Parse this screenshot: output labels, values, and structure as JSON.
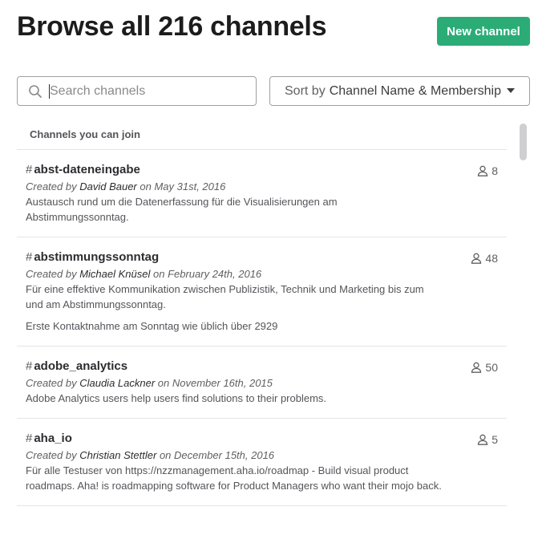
{
  "header": {
    "title": "Browse all 216 channels",
    "new_channel_label": "New channel"
  },
  "search": {
    "placeholder": "Search channels",
    "value": ""
  },
  "sort": {
    "prefix": "Sort by",
    "value": "Channel Name & Membership"
  },
  "list": {
    "section_title": "Channels you can join",
    "channels": [
      {
        "hash": "#",
        "name": "abst-dateneingabe",
        "members": "8",
        "created_prefix": "Created by",
        "author": "David Bauer",
        "created_suffix": "on May 31st, 2016",
        "description": "Austausch rund um die Datenerfassung für die Visualisierungen am Abstimmungssonntag.",
        "description2": ""
      },
      {
        "hash": "#",
        "name": "abstimmungssonntag",
        "members": "48",
        "created_prefix": "Created by",
        "author": "Michael Knüsel",
        "created_suffix": "on February 24th, 2016",
        "description": "Für eine effektive Kommunikation zwischen Publizistik, Technik und Marketing bis zum und am Abstimmungssonntag.",
        "description2": "Erste Kontaktnahme am Sonntag wie üblich über 2929"
      },
      {
        "hash": "#",
        "name": "adobe_analytics",
        "members": "50",
        "created_prefix": "Created by",
        "author": "Claudia Lackner",
        "created_suffix": "on November 16th, 2015",
        "description": "Adobe Analytics users help users find solutions to their problems.",
        "description2": ""
      },
      {
        "hash": "#",
        "name": "aha_io",
        "members": "5",
        "created_prefix": "Created by",
        "author": "Christian Stettler",
        "created_suffix": "on December 15th, 2016",
        "description": "Für alle Testuser von https://nzzmanagement.aha.io/roadmap -  Build visual product roadmaps. Aha! is roadmapping software for Product Managers who want their mojo back.",
        "description2": ""
      }
    ]
  },
  "colors": {
    "accent": "#2bac76",
    "text": "#2c2d30",
    "muted": "#616061",
    "border": "#e5e5e5"
  },
  "icons": {
    "search": "search-icon",
    "members": "person-icon",
    "sort": "chevron-down-icon"
  }
}
